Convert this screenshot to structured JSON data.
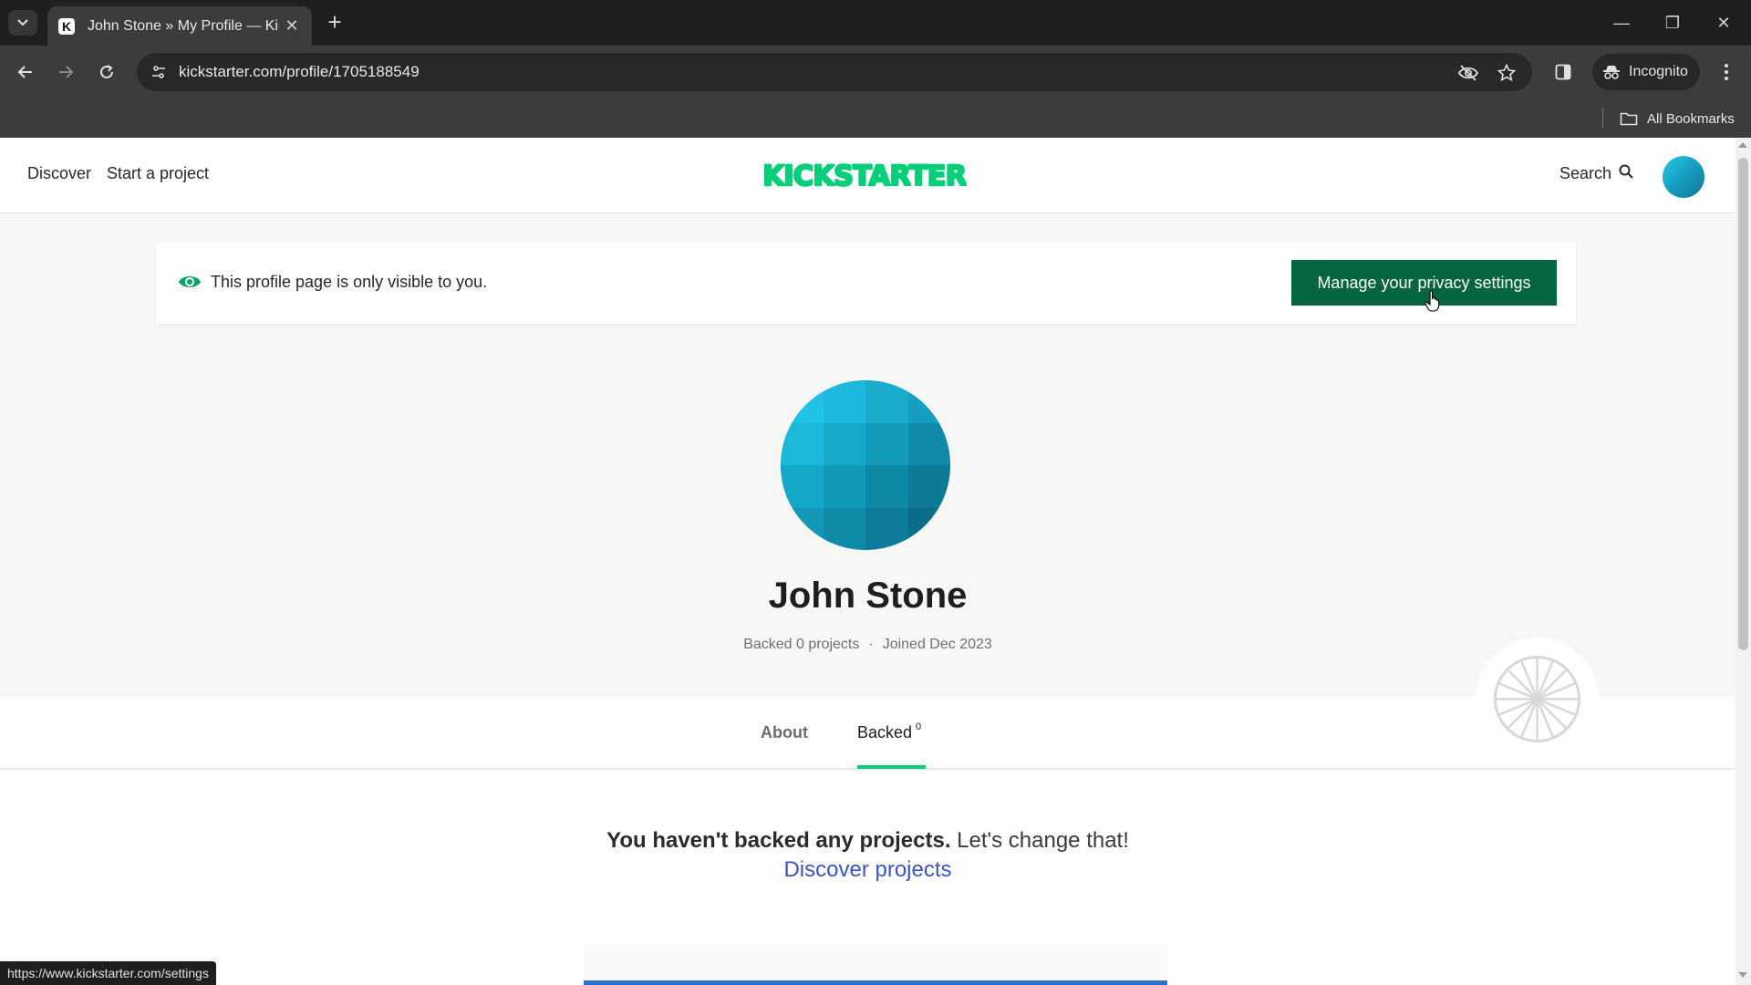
{
  "browser": {
    "tab_title": "John Stone » My Profile — Kick",
    "url": "kickstarter.com/profile/1705188549",
    "incognito_label": "Incognito",
    "all_bookmarks_label": "All Bookmarks",
    "status_url": "https://www.kickstarter.com/settings"
  },
  "header": {
    "nav": [
      "Discover",
      "Start a project"
    ],
    "logo_text": "KICKSTARTER",
    "search_label": "Search"
  },
  "privacy": {
    "message": "This profile page is only visible to you.",
    "button_label": "Manage your privacy settings"
  },
  "profile": {
    "name": "John Stone",
    "backed_text": "Backed 0 projects",
    "separator": "·",
    "joined_text": "Joined Dec 2023"
  },
  "tabs": {
    "about": "About",
    "backed": "Backed",
    "backed_count": "0"
  },
  "empty_state": {
    "bold": "You haven't backed any projects.",
    "rest": " Let's change that!",
    "link": "Discover projects"
  },
  "colors": {
    "brand_green": "#05ce78",
    "button_green": "#05653f",
    "link_blue": "#3a55c7"
  }
}
